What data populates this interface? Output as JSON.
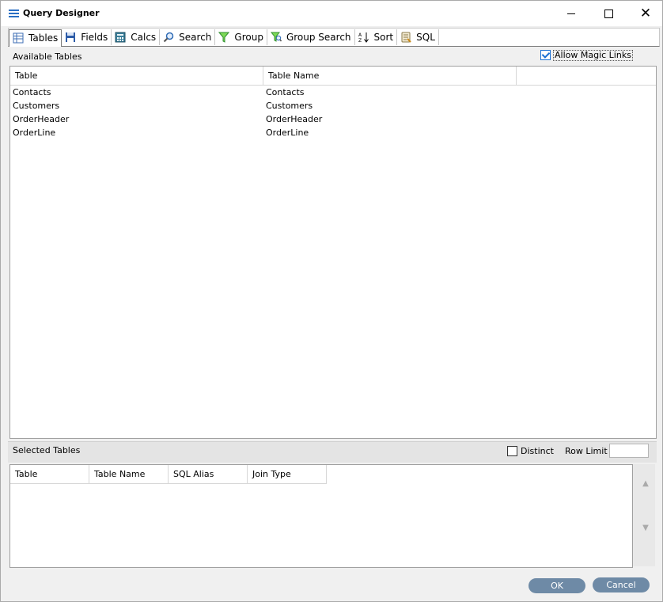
{
  "window": {
    "title": "Query Designer"
  },
  "toolbar": {
    "items": [
      {
        "label": "Tables",
        "icon": "table-icon"
      },
      {
        "label": "Fields",
        "icon": "save-icon"
      },
      {
        "label": "Calcs",
        "icon": "calculator-icon"
      },
      {
        "label": "Search",
        "icon": "magnifier-icon"
      },
      {
        "label": "Group",
        "icon": "funnel-icon"
      },
      {
        "label": "Group Search",
        "icon": "funnel-search-icon"
      },
      {
        "label": "Sort",
        "icon": "sort-az-icon"
      },
      {
        "label": "SQL",
        "icon": "sql-script-icon"
      }
    ]
  },
  "available": {
    "label": "Available Tables",
    "magic_links_label": "Allow Magic Links",
    "magic_links_checked": true,
    "columns": [
      "Table",
      "Table Name"
    ],
    "rows": [
      [
        "Contacts",
        "Contacts"
      ],
      [
        "Customers",
        "Customers"
      ],
      [
        "OrderHeader",
        "OrderHeader"
      ],
      [
        "OrderLine",
        "OrderLine"
      ]
    ]
  },
  "selected": {
    "label": "Selected Tables",
    "distinct_label": "Distinct",
    "distinct_checked": false,
    "row_limit_label": "Row Limit",
    "row_limit_value": "",
    "columns": [
      "Table",
      "Table Name",
      "SQL Alias",
      "Join Type"
    ]
  },
  "footer": {
    "ok_label": "OK",
    "cancel_label": "Cancel"
  },
  "colors": {
    "accent": "#2a6fc4",
    "button": "#6e8aa6"
  }
}
